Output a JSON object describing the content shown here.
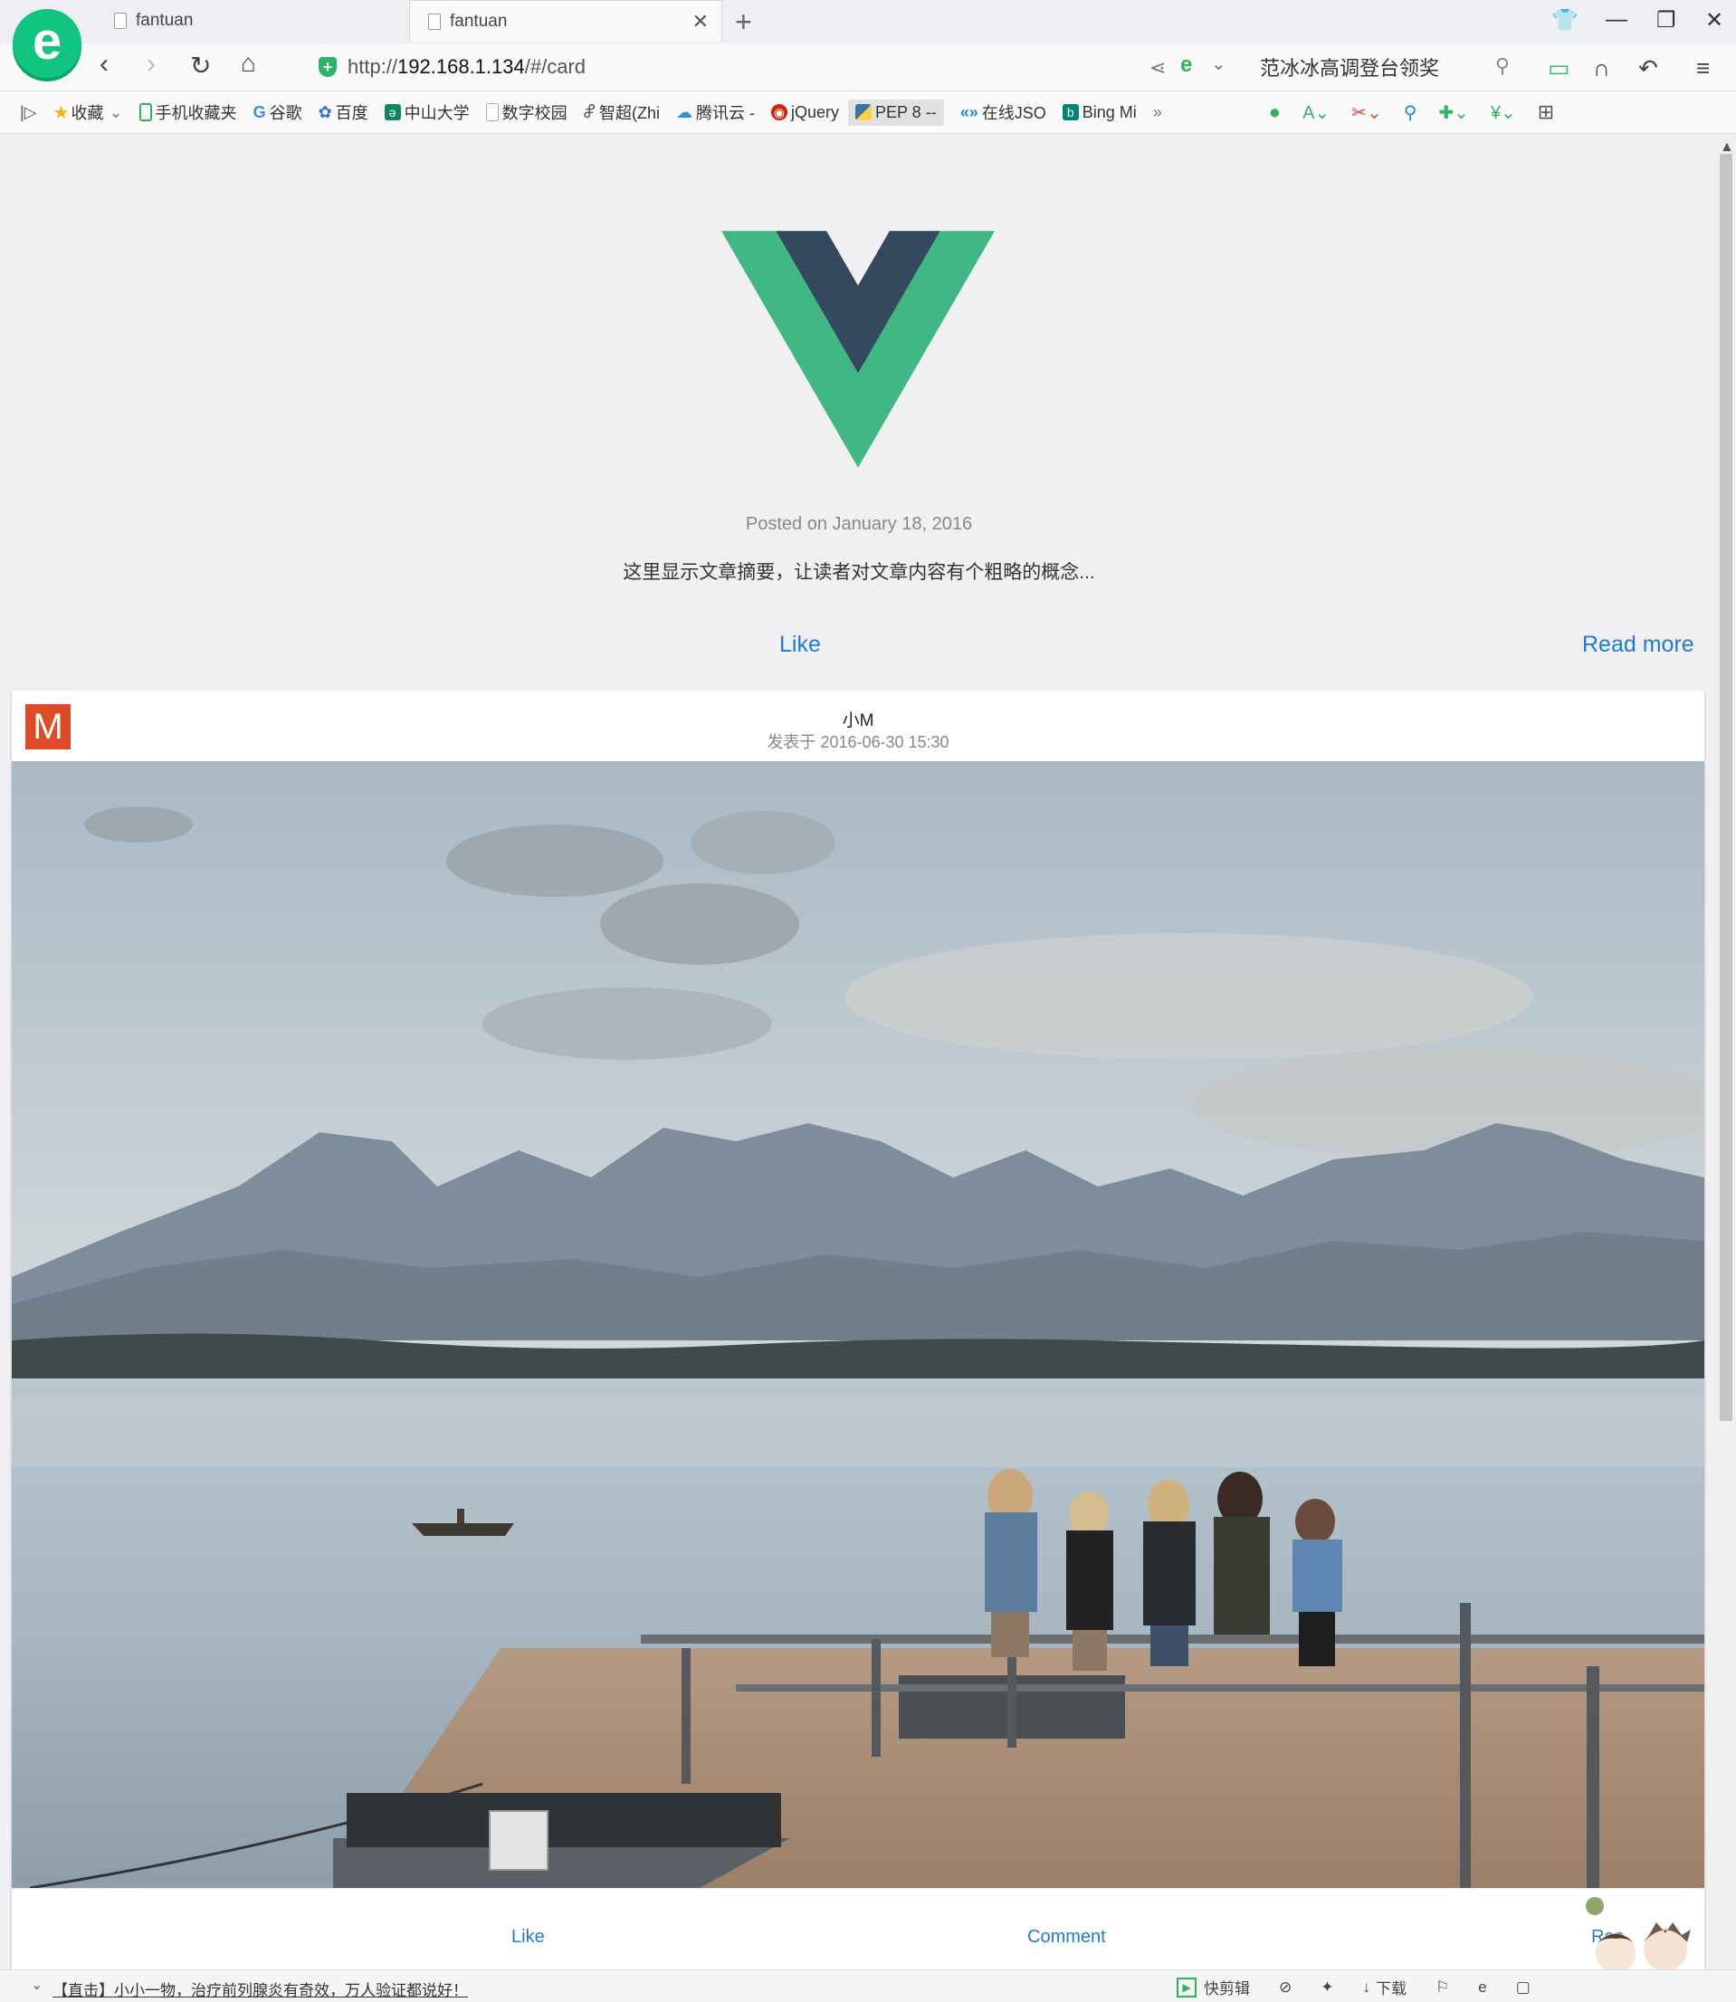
{
  "browser": {
    "tabs": [
      {
        "title": "fantuan"
      },
      {
        "title": "fantuan"
      }
    ],
    "address": {
      "scheme": "http://",
      "host": "192.168.1.134",
      "path": "/#/card"
    },
    "search_text": "范冰冰高调登台领奖",
    "bookmarks": [
      {
        "label": "收藏",
        "icon": "star-icon",
        "color": "#f5b400"
      },
      {
        "label": "手机收藏夹",
        "icon": "phone-icon",
        "color": "#2db55d"
      },
      {
        "label": "谷歌",
        "icon": "google-icon",
        "color": "#4285f4"
      },
      {
        "label": "百度",
        "icon": "baidu-icon",
        "color": "#2f6fe4"
      },
      {
        "label": "中山大学",
        "icon": "sysu-icon",
        "color": "#0b8a60"
      },
      {
        "label": "数字校园",
        "icon": "page-icon",
        "color": "#bbbbbb"
      },
      {
        "label": "智超(Zhi",
        "icon": "zhichao-icon",
        "color": "#555555"
      },
      {
        "label": "腾讯云 -",
        "icon": "cloud-icon",
        "color": "#2f8fe6"
      },
      {
        "label": "jQuery",
        "icon": "jquery-icon",
        "color": "#d81e06"
      },
      {
        "label": "PEP 8 --",
        "icon": "python-icon",
        "color": "#3776ab"
      },
      {
        "label": "在线JSO",
        "icon": "json-icon",
        "color": "#1e88e5"
      },
      {
        "label": "Bing Mi",
        "icon": "bing-icon",
        "color": "#008373"
      }
    ]
  },
  "post_summary": {
    "posted": "Posted on January 18, 2016",
    "summary": "这里显示文章摘要，让读者对文章内容有个粗略的概念...",
    "like": "Like",
    "read_more": "Read more"
  },
  "card": {
    "avatar_letter": "M",
    "author": "小M",
    "time": "发表于 2016-06-30 15:30",
    "footer": {
      "like": "Like",
      "comment": "Comment",
      "read": "Rea"
    }
  },
  "statusbar": {
    "news": "【直击】小小一物，治疗前列腺炎有奇效，万人验证都说好！",
    "quickcut": "快剪辑",
    "download": "下载"
  },
  "colors": {
    "vue_green": "#41b883",
    "vue_dark": "#35495e",
    "link_blue": "#1d7bd6",
    "avatar_red": "#dd4b27"
  }
}
